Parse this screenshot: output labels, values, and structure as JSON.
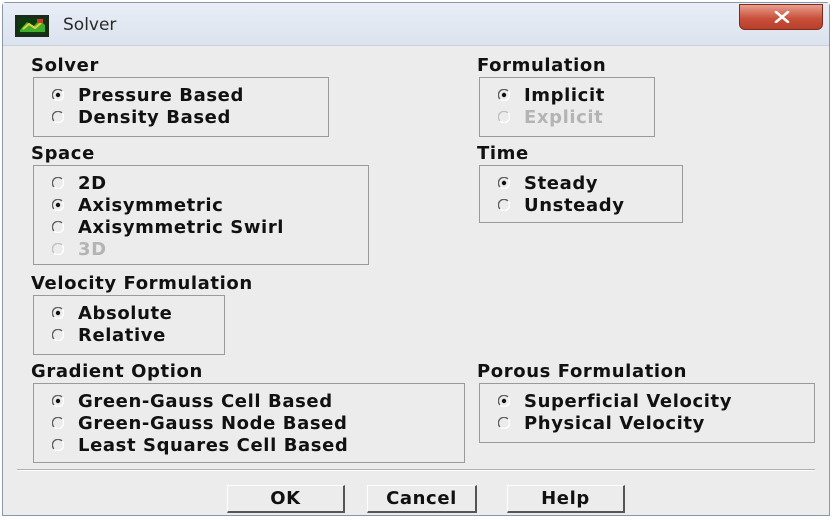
{
  "window": {
    "title": "Solver",
    "close_icon": "x-icon"
  },
  "solver": {
    "label": "Solver",
    "options": [
      {
        "label": "Pressure Based",
        "selected": true,
        "enabled": true
      },
      {
        "label": "Density Based",
        "selected": false,
        "enabled": true
      }
    ]
  },
  "formulation": {
    "label": "Formulation",
    "options": [
      {
        "label": "Implicit",
        "selected": true,
        "enabled": true
      },
      {
        "label": "Explicit",
        "selected": false,
        "enabled": false
      }
    ]
  },
  "space": {
    "label": "Space",
    "options": [
      {
        "label": "2D",
        "selected": false,
        "enabled": true
      },
      {
        "label": "Axisymmetric",
        "selected": true,
        "enabled": true
      },
      {
        "label": "Axisymmetric Swirl",
        "selected": false,
        "enabled": true
      },
      {
        "label": "3D",
        "selected": false,
        "enabled": false
      }
    ]
  },
  "time": {
    "label": "Time",
    "options": [
      {
        "label": "Steady",
        "selected": true,
        "enabled": true
      },
      {
        "label": "Unsteady",
        "selected": false,
        "enabled": true
      }
    ]
  },
  "velocity_formulation": {
    "label": "Velocity Formulation",
    "options": [
      {
        "label": "Absolute",
        "selected": true,
        "enabled": true
      },
      {
        "label": "Relative",
        "selected": false,
        "enabled": true
      }
    ]
  },
  "gradient_option": {
    "label": "Gradient Option",
    "options": [
      {
        "label": "Green-Gauss Cell Based",
        "selected": true,
        "enabled": true
      },
      {
        "label": "Green-Gauss Node Based",
        "selected": false,
        "enabled": true
      },
      {
        "label": "Least Squares Cell Based",
        "selected": false,
        "enabled": true
      }
    ]
  },
  "porous_formulation": {
    "label": "Porous Formulation",
    "options": [
      {
        "label": "Superficial Velocity",
        "selected": true,
        "enabled": true
      },
      {
        "label": "Physical Velocity",
        "selected": false,
        "enabled": true
      }
    ]
  },
  "buttons": {
    "ok": "OK",
    "cancel": "Cancel",
    "help": "Help"
  }
}
